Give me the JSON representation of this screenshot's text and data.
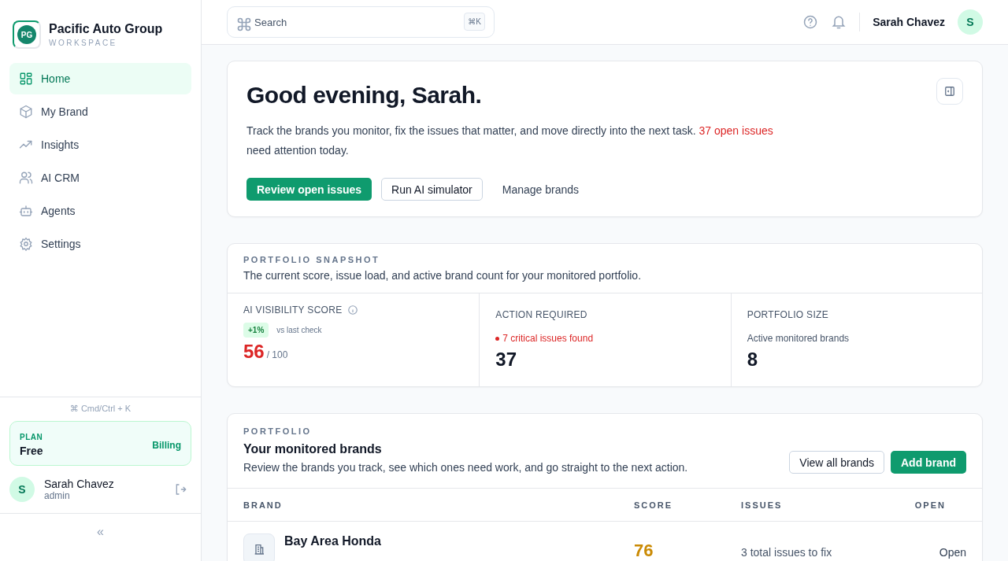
{
  "sidebar": {
    "org": {
      "initials": "PG",
      "name": "Pacific Auto Group",
      "subtitle": "WORKSPACE"
    },
    "nav": [
      {
        "label": "Home",
        "selected": true
      },
      {
        "label": "My Brand",
        "selected": false
      },
      {
        "label": "Insights",
        "selected": false
      },
      {
        "label": "AI CRM",
        "selected": false
      },
      {
        "label": "Agents",
        "selected": false
      },
      {
        "label": "Settings",
        "selected": false
      }
    ],
    "shortcut": "⌘ Cmd/Ctrl + K",
    "plan": {
      "label": "PLAN",
      "value": "Free",
      "link": "Billing"
    },
    "user": {
      "initial": "S",
      "name": "Sarah Chavez",
      "role": "admin"
    },
    "collapse": "«"
  },
  "header": {
    "search": {
      "placeholder": "Search",
      "shortcut": "⌘K"
    },
    "user": {
      "name": "Sarah Chavez",
      "initial": "S"
    }
  },
  "greeting": {
    "title": "Good evening, Sarah.",
    "text": "Track the brands you monitor, fix the issues that matter, and move directly into the next task. ",
    "highlight": "37 open issues",
    "suffix": " need attention today.",
    "actions": [
      {
        "label": "Review open issues",
        "kind": "primary"
      },
      {
        "label": "Run AI simulator",
        "kind": "outline"
      },
      {
        "label": "Manage brands",
        "kind": "ghost"
      }
    ]
  },
  "snapshot": {
    "eyebrow": "PORTFOLIO SNAPSHOT",
    "description": "The current score, issue load, and active brand count for your monitored portfolio.",
    "metrics": [
      {
        "kind": "score",
        "label": "AI VISIBILITY SCORE",
        "badge": "+1%",
        "note": "vs last check",
        "value": "56",
        "suffix": "/ 100"
      },
      {
        "kind": "alert",
        "label": "ACTION REQUIRED",
        "note": "7 critical issues found",
        "value": "37"
      },
      {
        "kind": "plain",
        "label": "PORTFOLIO SIZE",
        "note": "Active monitored brands",
        "value": "8"
      }
    ]
  },
  "portfolio": {
    "eyebrow": "PORTFOLIO",
    "title": "Your monitored brands",
    "description": "Review the brands you track, see which ones need work, and go straight to the next action.",
    "actions": [
      {
        "label": "View all brands",
        "kind": "outline"
      },
      {
        "label": "Add brand",
        "kind": "primary"
      }
    ],
    "table": {
      "columns": [
        "BRAND",
        "SCORE",
        "ISSUES",
        "OPEN"
      ],
      "rows": [
        {
          "brand": "Bay Area Honda",
          "score": "76",
          "issues": "3 total issues to fix",
          "open": "Open"
        }
      ]
    }
  }
}
